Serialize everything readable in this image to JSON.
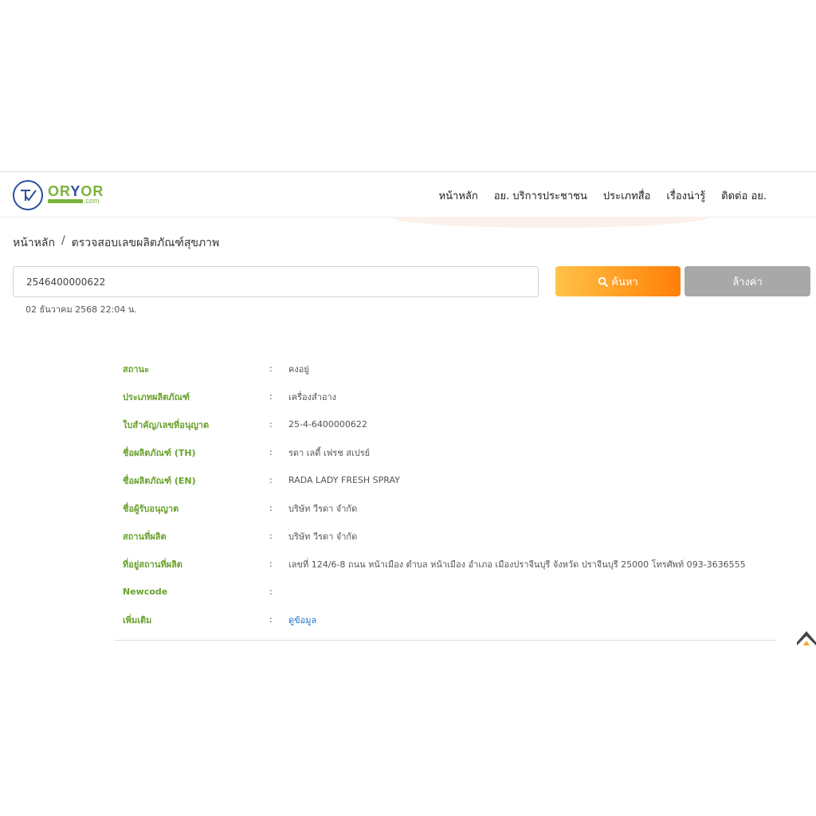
{
  "logo": {
    "text_a": "OR",
    "text_b": "Y",
    "text_c": "OR",
    "dotcom": ".com"
  },
  "nav": {
    "items": [
      "หน้าหลัก",
      "อย. บริการประชาชน",
      "ประเภทสื่อ",
      "เรื่องน่ารู้",
      "ติดต่อ อย."
    ]
  },
  "breadcrumb": {
    "home": "หน้าหลัก",
    "separator": "/",
    "current": "ตรวจสอบเลขผลิตภัณฑ์สุขภาพ"
  },
  "search": {
    "value": "2546400000622",
    "search_label": "ค้นหา",
    "clear_label": "ล้างค่า"
  },
  "timestamp": "02 ธันวาคม 2568 22:04 น.",
  "details": {
    "colon": ":",
    "rows": [
      {
        "label": "สถานะ",
        "value": "คงอยู่"
      },
      {
        "label": "ประเภทผลิตภัณฑ์",
        "value": "เครื่องสำอาง"
      },
      {
        "label": "ใบสำคัญ/เลขที่อนุญาต",
        "value": "25-4-6400000622"
      },
      {
        "label": "ชื่อผลิตภัณฑ์ (TH)",
        "value": "รดา เลดี้ เฟรช สเปรย์"
      },
      {
        "label": "ชื่อผลิตภัณฑ์ (EN)",
        "value": "RADA LADY FRESH SPRAY"
      },
      {
        "label": "ชื่อผู้รับอนุญาต",
        "value": "บริษัท วีรดา จำกัด"
      },
      {
        "label": "สถานที่ผลิต",
        "value": "บริษัท วีรดา จำกัด"
      },
      {
        "label": "ที่อยู่สถานที่ผลิต",
        "value": "เลขที่ 124/6-8 ถนน หน้าเมือง ตำบล หน้าเมือง อำเภอ เมืองปราจีนบุรี จังหวัด ปราจีนบุรี 25000 โทรศัพท์ 093-3636555"
      },
      {
        "label": "Newcode",
        "value": ""
      },
      {
        "label": "เพิ่มเติม",
        "value": "ดูข้อมูล"
      }
    ]
  },
  "colors": {
    "label_green": "#6aa12e",
    "search_orange": "#ff9a1f",
    "clear_gray": "#a8a8a8",
    "link_blue": "#1a6fd6"
  }
}
